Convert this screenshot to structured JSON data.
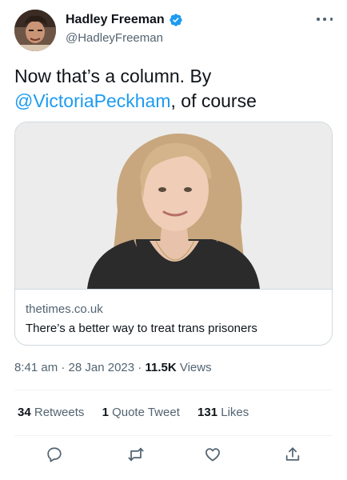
{
  "author": {
    "name": "Hadley Freeman",
    "handle": "@HadleyFreeman",
    "verified": true,
    "verified_color": "#1d9bf0"
  },
  "more_icon": "more-horizontal-icon",
  "tweet": {
    "text_before": "Now that’s a column. By",
    "mention": "@VictoriaPeckham",
    "text_after": ", of course"
  },
  "card": {
    "domain": "thetimes.co.uk",
    "title": "There’s a better way to treat trans prisoners"
  },
  "meta": {
    "time": "8:41 am",
    "separator": "·",
    "date": "28 Jan 2023",
    "views_count": "11.5K",
    "views_label": "Views"
  },
  "stats": {
    "retweets_count": "34",
    "retweets_label": "Retweets",
    "quotes_count": "1",
    "quotes_label": "Quote Tweet",
    "likes_count": "131",
    "likes_label": "Likes"
  },
  "actions": [
    "reply-icon",
    "retweet-icon",
    "like-icon",
    "share-icon"
  ],
  "colors": {
    "link": "#1d9bf0",
    "secondary_text": "#536471",
    "primary_text": "#0f1419",
    "border": "#cfd9de"
  }
}
